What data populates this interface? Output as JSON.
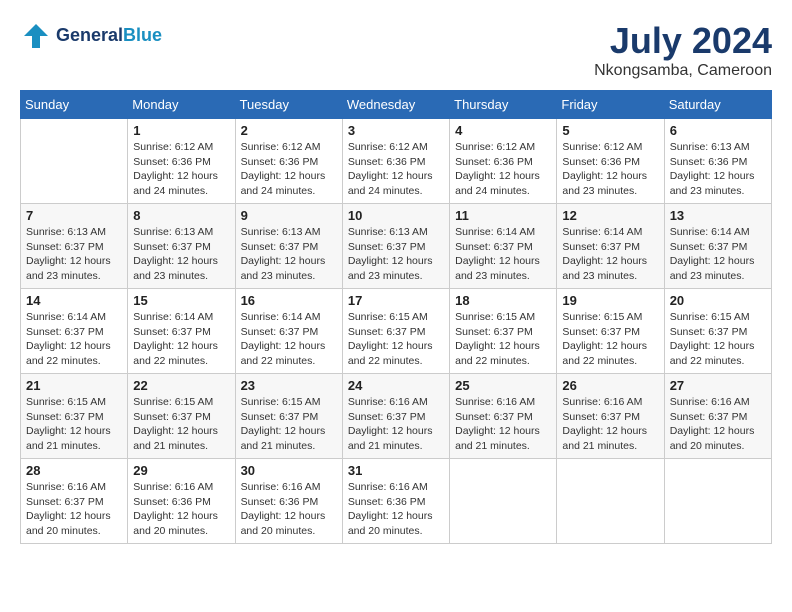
{
  "header": {
    "logo_line1": "General",
    "logo_line2": "Blue",
    "month": "July 2024",
    "location": "Nkongsamba, Cameroon"
  },
  "weekdays": [
    "Sunday",
    "Monday",
    "Tuesday",
    "Wednesday",
    "Thursday",
    "Friday",
    "Saturday"
  ],
  "weeks": [
    [
      {
        "day": "",
        "info": ""
      },
      {
        "day": "1",
        "info": "Sunrise: 6:12 AM\nSunset: 6:36 PM\nDaylight: 12 hours\nand 24 minutes."
      },
      {
        "day": "2",
        "info": "Sunrise: 6:12 AM\nSunset: 6:36 PM\nDaylight: 12 hours\nand 24 minutes."
      },
      {
        "day": "3",
        "info": "Sunrise: 6:12 AM\nSunset: 6:36 PM\nDaylight: 12 hours\nand 24 minutes."
      },
      {
        "day": "4",
        "info": "Sunrise: 6:12 AM\nSunset: 6:36 PM\nDaylight: 12 hours\nand 24 minutes."
      },
      {
        "day": "5",
        "info": "Sunrise: 6:12 AM\nSunset: 6:36 PM\nDaylight: 12 hours\nand 23 minutes."
      },
      {
        "day": "6",
        "info": "Sunrise: 6:13 AM\nSunset: 6:36 PM\nDaylight: 12 hours\nand 23 minutes."
      }
    ],
    [
      {
        "day": "7",
        "info": "Sunrise: 6:13 AM\nSunset: 6:37 PM\nDaylight: 12 hours\nand 23 minutes."
      },
      {
        "day": "8",
        "info": "Sunrise: 6:13 AM\nSunset: 6:37 PM\nDaylight: 12 hours\nand 23 minutes."
      },
      {
        "day": "9",
        "info": "Sunrise: 6:13 AM\nSunset: 6:37 PM\nDaylight: 12 hours\nand 23 minutes."
      },
      {
        "day": "10",
        "info": "Sunrise: 6:13 AM\nSunset: 6:37 PM\nDaylight: 12 hours\nand 23 minutes."
      },
      {
        "day": "11",
        "info": "Sunrise: 6:14 AM\nSunset: 6:37 PM\nDaylight: 12 hours\nand 23 minutes."
      },
      {
        "day": "12",
        "info": "Sunrise: 6:14 AM\nSunset: 6:37 PM\nDaylight: 12 hours\nand 23 minutes."
      },
      {
        "day": "13",
        "info": "Sunrise: 6:14 AM\nSunset: 6:37 PM\nDaylight: 12 hours\nand 23 minutes."
      }
    ],
    [
      {
        "day": "14",
        "info": "Sunrise: 6:14 AM\nSunset: 6:37 PM\nDaylight: 12 hours\nand 22 minutes."
      },
      {
        "day": "15",
        "info": "Sunrise: 6:14 AM\nSunset: 6:37 PM\nDaylight: 12 hours\nand 22 minutes."
      },
      {
        "day": "16",
        "info": "Sunrise: 6:14 AM\nSunset: 6:37 PM\nDaylight: 12 hours\nand 22 minutes."
      },
      {
        "day": "17",
        "info": "Sunrise: 6:15 AM\nSunset: 6:37 PM\nDaylight: 12 hours\nand 22 minutes."
      },
      {
        "day": "18",
        "info": "Sunrise: 6:15 AM\nSunset: 6:37 PM\nDaylight: 12 hours\nand 22 minutes."
      },
      {
        "day": "19",
        "info": "Sunrise: 6:15 AM\nSunset: 6:37 PM\nDaylight: 12 hours\nand 22 minutes."
      },
      {
        "day": "20",
        "info": "Sunrise: 6:15 AM\nSunset: 6:37 PM\nDaylight: 12 hours\nand 22 minutes."
      }
    ],
    [
      {
        "day": "21",
        "info": "Sunrise: 6:15 AM\nSunset: 6:37 PM\nDaylight: 12 hours\nand 21 minutes."
      },
      {
        "day": "22",
        "info": "Sunrise: 6:15 AM\nSunset: 6:37 PM\nDaylight: 12 hours\nand 21 minutes."
      },
      {
        "day": "23",
        "info": "Sunrise: 6:15 AM\nSunset: 6:37 PM\nDaylight: 12 hours\nand 21 minutes."
      },
      {
        "day": "24",
        "info": "Sunrise: 6:16 AM\nSunset: 6:37 PM\nDaylight: 12 hours\nand 21 minutes."
      },
      {
        "day": "25",
        "info": "Sunrise: 6:16 AM\nSunset: 6:37 PM\nDaylight: 12 hours\nand 21 minutes."
      },
      {
        "day": "26",
        "info": "Sunrise: 6:16 AM\nSunset: 6:37 PM\nDaylight: 12 hours\nand 21 minutes."
      },
      {
        "day": "27",
        "info": "Sunrise: 6:16 AM\nSunset: 6:37 PM\nDaylight: 12 hours\nand 20 minutes."
      }
    ],
    [
      {
        "day": "28",
        "info": "Sunrise: 6:16 AM\nSunset: 6:37 PM\nDaylight: 12 hours\nand 20 minutes."
      },
      {
        "day": "29",
        "info": "Sunrise: 6:16 AM\nSunset: 6:36 PM\nDaylight: 12 hours\nand 20 minutes."
      },
      {
        "day": "30",
        "info": "Sunrise: 6:16 AM\nSunset: 6:36 PM\nDaylight: 12 hours\nand 20 minutes."
      },
      {
        "day": "31",
        "info": "Sunrise: 6:16 AM\nSunset: 6:36 PM\nDaylight: 12 hours\nand 20 minutes."
      },
      {
        "day": "",
        "info": ""
      },
      {
        "day": "",
        "info": ""
      },
      {
        "day": "",
        "info": ""
      }
    ]
  ]
}
